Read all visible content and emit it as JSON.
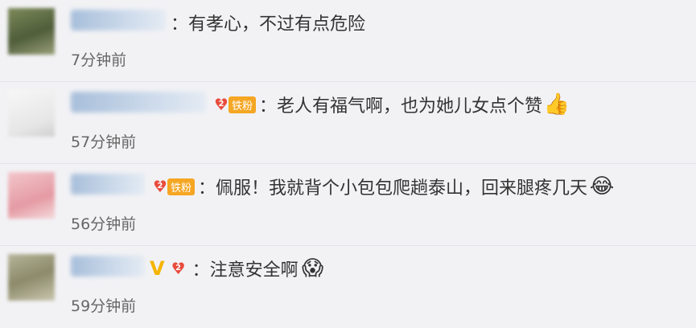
{
  "comments": [
    {
      "name": "",
      "badges": [],
      "text": "：有孝心，不过有点危险",
      "emoji": "",
      "time": "7分钟前"
    },
    {
      "name": "",
      "badges": [
        "fan"
      ],
      "fan_label": "铁粉",
      "text": "：老人有福气啊，也为她儿女点个赞",
      "emoji": "thumbs-up-icon",
      "time": "57分钟前"
    },
    {
      "name": "",
      "badges": [
        "fan"
      ],
      "fan_label": "铁粉",
      "text": "：佩服！我就背个小包包爬趟泰山，回来腿疼几天",
      "emoji": "laughing-tears-icon",
      "time": "56分钟前"
    },
    {
      "name": "",
      "badges": [
        "verified",
        "fan-level"
      ],
      "verified_label": "V",
      "text": "：注意安全啊",
      "emoji": "shocked-face-icon",
      "time": "59分钟前"
    }
  ],
  "colors": {
    "background": "#f2f2f5",
    "name_link": "#5b84b1",
    "fan_badge": "#f5a623",
    "verified_badge": "#f5b400"
  }
}
